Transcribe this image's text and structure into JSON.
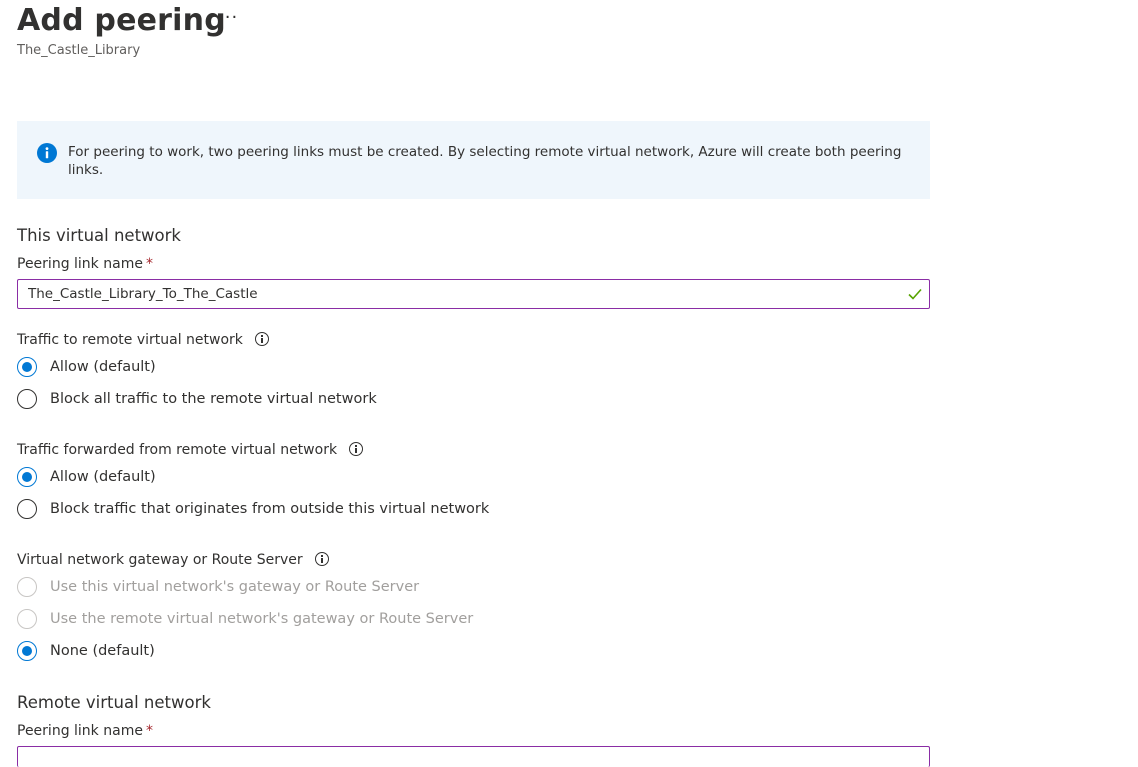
{
  "header": {
    "title": "Add peering",
    "more_label": "···",
    "subtitle": "The_Castle_Library"
  },
  "info": {
    "text": "For peering to work, two peering links must be created. By selecting remote virtual network, Azure will create both peering links."
  },
  "this_network": {
    "section_title": "This virtual network",
    "peering_link_name_label": "Peering link name",
    "required_mark": "*",
    "peering_link_name_value": "The_Castle_Library_To_The_Castle",
    "traffic_to_remote": {
      "label": "Traffic to remote virtual network",
      "options": [
        "Allow (default)",
        "Block all traffic to the remote virtual network"
      ],
      "selected": "Allow (default)"
    },
    "traffic_forwarded": {
      "label": "Traffic forwarded from remote virtual network",
      "options": [
        "Allow (default)",
        "Block traffic that originates from outside this virtual network"
      ],
      "selected": "Allow (default)"
    },
    "gateway": {
      "label": "Virtual network gateway or Route Server",
      "options": [
        "Use this virtual network's gateway or Route Server",
        "Use the remote virtual network's gateway or Route Server",
        "None (default)"
      ],
      "selected": "None (default)"
    }
  },
  "remote_network": {
    "section_title": "Remote virtual network",
    "peering_link_name_label": "Peering link name",
    "required_mark": "*"
  },
  "colors": {
    "accent": "#0078d4",
    "input_border": "#8a2da5",
    "valid_check": "#57a300",
    "info_background": "#eff6fc",
    "required": "#a4262c"
  },
  "icons": {
    "info": "info-icon",
    "valid": "checkmark-icon",
    "tooltip": "info-tooltip-icon"
  }
}
